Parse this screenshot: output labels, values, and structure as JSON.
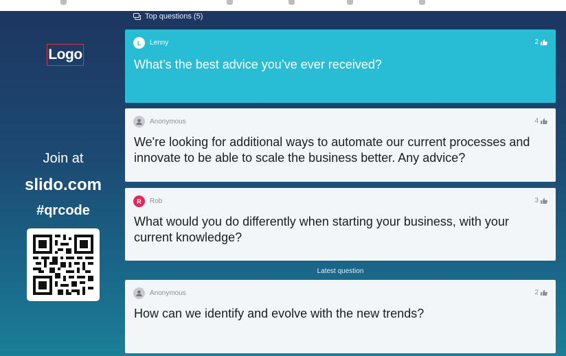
{
  "sidebar": {
    "logo": "Logo",
    "join_at": "Join at",
    "join_url": "slido.com",
    "join_code": "#qrcode"
  },
  "top_questions": {
    "label": "Top questions (5)",
    "icon": "chat-bubbles-icon",
    "items": [
      {
        "author": "Lenny",
        "avatar_initial": "L",
        "votes": "2",
        "text": "What’s the best advice you’ve ever received?"
      },
      {
        "author": "Anonymous",
        "avatar_initial": "",
        "votes": "4",
        "text": "We're looking for additional ways to automate our current processes and innovate to be able to scale the business better. Any advice?"
      },
      {
        "author": "Rob",
        "avatar_initial": "R",
        "votes": "3",
        "text": "What would you do differently when starting your business, with your current knowledge?"
      }
    ]
  },
  "latest": {
    "label": "Latest question",
    "author": "Anonymous",
    "avatar_initial": "",
    "votes": "2",
    "text": "How can we identify and evolve with the new trends?"
  },
  "colors": {
    "highlight_card": "#29bcd5",
    "card": "#f3f6f9",
    "rob_avatar": "#e5275b"
  }
}
